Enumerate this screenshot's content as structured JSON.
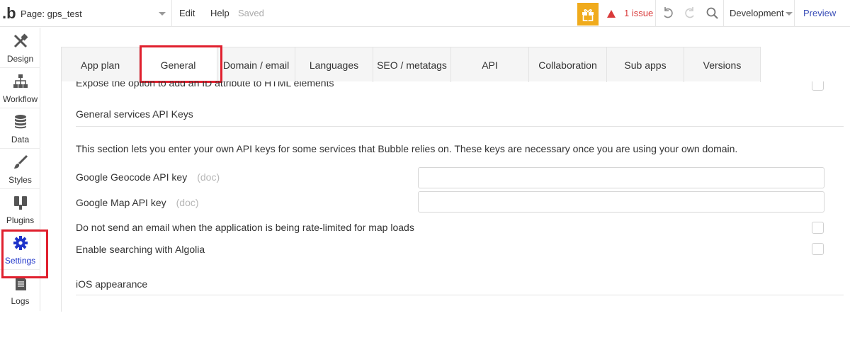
{
  "header": {
    "logo": ".b",
    "page_label": "Page: gps_test",
    "menu_edit": "Edit",
    "menu_help": "Help",
    "save_status": "Saved",
    "issue_text": "1 issue",
    "environment": "Development",
    "preview": "Preview",
    "accent_color": "#f0ab1c",
    "issue_color": "#d93a3a"
  },
  "sidebar": {
    "items": [
      {
        "label": "Design",
        "icon": "design-icon"
      },
      {
        "label": "Workflow",
        "icon": "workflow-icon"
      },
      {
        "label": "Data",
        "icon": "database-icon"
      },
      {
        "label": "Styles",
        "icon": "brush-icon"
      },
      {
        "label": "Plugins",
        "icon": "plug-icon"
      },
      {
        "label": "Settings",
        "icon": "gear-icon",
        "active": true
      },
      {
        "label": "Logs",
        "icon": "document-icon"
      }
    ]
  },
  "tabs": [
    {
      "label": "App plan"
    },
    {
      "label": "General",
      "active": true
    },
    {
      "label": "Domain / email"
    },
    {
      "label": "Languages"
    },
    {
      "label": "SEO / metatags"
    },
    {
      "label": "API"
    },
    {
      "label": "Collaboration"
    },
    {
      "label": "Sub apps"
    },
    {
      "label": "Versions"
    }
  ],
  "content": {
    "cutoff_text": "Expose the option to add an ID attribute to HTML elements",
    "api_keys_heading": "General services API Keys",
    "api_keys_description": "This section lets you enter your own API keys for some services that Bubble relies on. These keys are necessary once you are using your own domain.",
    "geocode_label": "Google Geocode API key",
    "geocode_doc": "(doc)",
    "geocode_value": "",
    "map_label": "Google Map API key",
    "map_doc": "(doc)",
    "map_value": "",
    "rate_limit_label": "Do not send an email when the application is being rate-limited for map loads",
    "algolia_label": "Enable searching with Algolia",
    "ios_heading": "iOS appearance"
  }
}
